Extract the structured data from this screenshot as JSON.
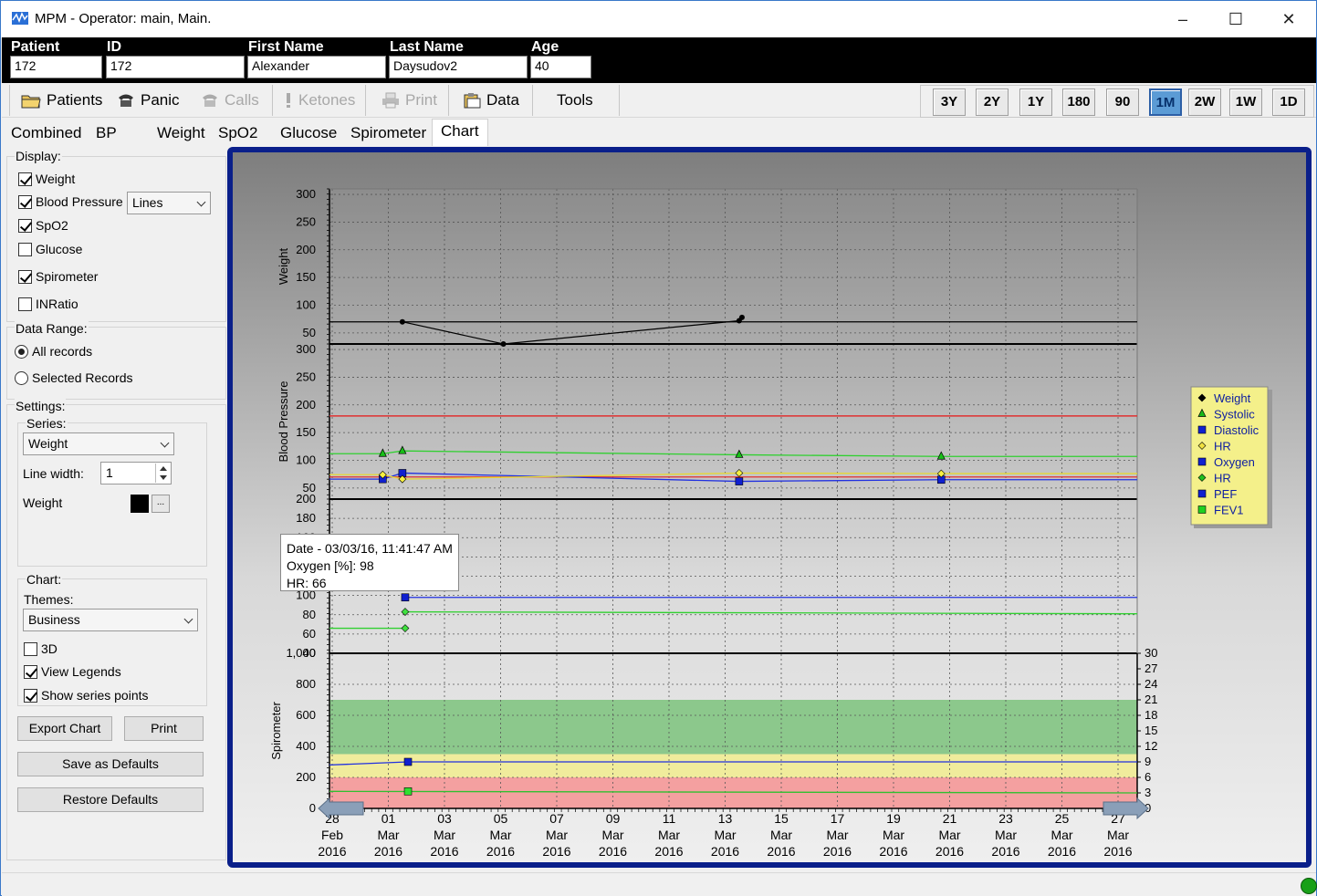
{
  "window": {
    "title": "MPM - Operator: main, Main.",
    "minimize": "–",
    "maximize": "☐",
    "close": "✕"
  },
  "patient": {
    "fields": [
      {
        "label": "Patient",
        "value": "172"
      },
      {
        "label": "ID",
        "value": "172"
      },
      {
        "label": "First Name",
        "value": "Alexander"
      },
      {
        "label": "Last Name",
        "value": "Daysudov2"
      },
      {
        "label": "Age",
        "value": "40"
      }
    ]
  },
  "toolbar": {
    "patients": "Patients",
    "panic": "Panic",
    "calls": "Calls",
    "ketones": "Ketones",
    "print": "Print",
    "data": "Data",
    "tools": "Tools"
  },
  "ranges": {
    "items": [
      "3Y",
      "2Y",
      "1Y",
      "180",
      "90",
      "1M",
      "2W",
      "1W",
      "1D"
    ],
    "active": "1M"
  },
  "tabs": {
    "combined": "Combined",
    "bp": "BP",
    "weight": "Weight",
    "spo2": "SpO2",
    "glucose": "Glucose",
    "spirometer": "Spirometer",
    "chart": "Chart"
  },
  "display": {
    "label": "Display:",
    "weight": "Weight",
    "blood_pressure": "Blood Pressure",
    "bp_mode": "Lines",
    "spo2": "SpO2",
    "glucose": "Glucose",
    "spirometer": "Spirometer",
    "inratio": "INRatio"
  },
  "data_range": {
    "label": "Data Range:",
    "all": "All records",
    "selected": "Selected Records"
  },
  "settings": {
    "label": "Settings:",
    "series_label": "Series:",
    "series_value": "Weight",
    "line_width_label": "Line width:",
    "line_width": "1",
    "color_label": "Weight",
    "color_btn": "..."
  },
  "chart_settings": {
    "label": "Chart:",
    "themes_label": "Themes:",
    "theme": "Business",
    "three_d": "3D",
    "view_legends": "View Legends",
    "show_points": "Show series points"
  },
  "buttons": {
    "export": "Export Chart",
    "print": "Print",
    "save_defaults": "Save as Defaults",
    "restore_defaults": "Restore Defaults"
  },
  "tooltip": {
    "date": "Date - 03/03/16, 11:41:47 AM",
    "oxygen": "Oxygen [%]:  98",
    "hr": "HR:  66"
  },
  "chart_data": [
    {
      "type": "line",
      "ylabel": "Weight",
      "ylim": [
        30,
        310
      ],
      "yticks": [
        50,
        100,
        150,
        200,
        250,
        300
      ],
      "series": [
        {
          "name": "Weight",
          "x": [
            2.5,
            6.1,
            14.5,
            14.6
          ],
          "values": [
            70,
            30,
            72,
            78
          ]
        }
      ],
      "hline": 70
    },
    {
      "type": "line",
      "ylabel": "Blood Pressure",
      "ylim": [
        30,
        310
      ],
      "yticks": [
        50,
        100,
        150,
        200,
        250,
        300
      ],
      "reference_line": 180,
      "series": [
        {
          "name": "Systolic",
          "x": [
            1.8,
            2.5,
            14.5,
            21.7
          ],
          "values": [
            112,
            117,
            110,
            107
          ]
        },
        {
          "name": "Diastolic",
          "x": [
            1.8,
            2.5,
            14.5,
            21.7
          ],
          "values": [
            66,
            77,
            62,
            65
          ]
        },
        {
          "name": "HR",
          "x": [
            1.8,
            2.5,
            14.5,
            21.7
          ],
          "values": [
            74,
            66,
            77,
            76
          ]
        }
      ]
    },
    {
      "type": "line",
      "ylim": [
        40,
        200
      ],
      "yticks": [
        40,
        60,
        80,
        100,
        120,
        140,
        160,
        180,
        200
      ],
      "series": [
        {
          "name": "Oxygen",
          "x": [
            2.6
          ],
          "values": [
            98
          ]
        },
        {
          "name": "HR",
          "x": [
            2.6,
            2.6
          ],
          "values": [
            83,
            66
          ]
        }
      ]
    },
    {
      "type": "line",
      "ylabel": "Spirometer",
      "ylim": [
        0,
        1000
      ],
      "yticks": [
        0,
        200,
        400,
        600,
        800,
        1000
      ],
      "y2ticks": [
        0,
        3,
        6,
        9,
        12,
        15,
        18,
        21,
        24,
        27,
        30
      ],
      "zones": [
        {
          "from": 0,
          "to": 200,
          "color": "#f4a0a0"
        },
        {
          "from": 200,
          "to": 350,
          "color": "#f0ec9c"
        },
        {
          "from": 350,
          "to": 700,
          "color": "#8cc88c"
        }
      ],
      "series": [
        {
          "name": "PEF",
          "x": [
            2.7
          ],
          "values": [
            300
          ]
        },
        {
          "name": "FEV1",
          "x": [
            2.7
          ],
          "values": [
            110
          ]
        }
      ]
    }
  ],
  "x_axis": {
    "ticks": [
      {
        "day": "28",
        "month": "Feb",
        "year": "2016"
      },
      {
        "day": "01",
        "month": "Mar",
        "year": "2016"
      },
      {
        "day": "03",
        "month": "Mar",
        "year": "2016"
      },
      {
        "day": "05",
        "month": "Mar",
        "year": "2016"
      },
      {
        "day": "07",
        "month": "Mar",
        "year": "2016"
      },
      {
        "day": "09",
        "month": "Mar",
        "year": "2016"
      },
      {
        "day": "11",
        "month": "Mar",
        "year": "2016"
      },
      {
        "day": "13",
        "month": "Mar",
        "year": "2016"
      },
      {
        "day": "15",
        "month": "Mar",
        "year": "2016"
      },
      {
        "day": "17",
        "month": "Mar",
        "year": "2016"
      },
      {
        "day": "19",
        "month": "Mar",
        "year": "2016"
      },
      {
        "day": "21",
        "month": "Mar",
        "year": "2016"
      },
      {
        "day": "23",
        "month": "Mar",
        "year": "2016"
      },
      {
        "day": "25",
        "month": "Mar",
        "year": "2016"
      },
      {
        "day": "27",
        "month": "Mar",
        "year": "2016"
      }
    ]
  },
  "legend": [
    {
      "name": "Weight",
      "marker": "diamond",
      "color": "#000000"
    },
    {
      "name": "Systolic",
      "marker": "triangle",
      "color": "#18b818"
    },
    {
      "name": "Diastolic",
      "marker": "square",
      "color": "#1020d0"
    },
    {
      "name": "HR",
      "marker": "diamond",
      "color": "#f0e040"
    },
    {
      "name": "Oxygen",
      "marker": "square",
      "color": "#1020d0"
    },
    {
      "name": "HR",
      "marker": "diamond",
      "color": "#20c020"
    },
    {
      "name": "PEF",
      "marker": "square",
      "color": "#1020d0"
    },
    {
      "name": "FEV1",
      "marker": "square",
      "color": "#20d020"
    }
  ]
}
